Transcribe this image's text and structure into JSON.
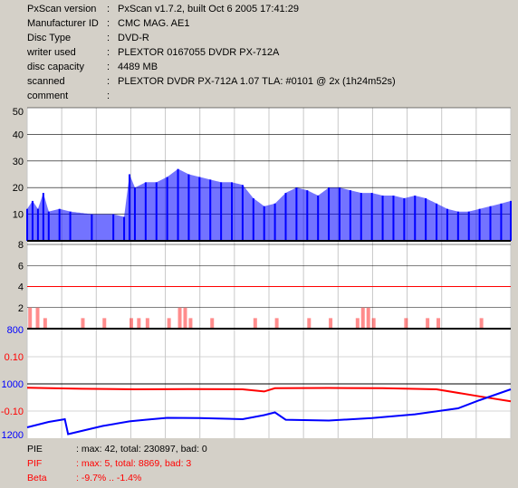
{
  "info": [
    {
      "key": "PxScan version",
      "value": "PxScan v1.7.2, built Oct  6 2005 17:41:29"
    },
    {
      "key": "Manufacturer ID",
      "value": "CMC MAG. AE1"
    },
    {
      "key": "Disc Type",
      "value": "DVD-R"
    },
    {
      "key": "writer used",
      "value": "PLEXTOR 0167055 DVDR PX-712A"
    },
    {
      "key": "disc capacity",
      "value": "4489 MB"
    },
    {
      "key": "scanned",
      "value": "PLEXTOR DVDR PX-712A 1.07 TLA: #0101 @ 2x (1h24m52s)"
    },
    {
      "key": "comment",
      "value": ""
    }
  ],
  "separator": ":",
  "summary": [
    {
      "key": "PIE",
      "value": ": max: 42, total: 230897, bad: 0",
      "color": "#000000"
    },
    {
      "key": "PIF",
      "value": ": max: 5, total: 8869, bad: 3",
      "color": "#ff0000"
    },
    {
      "key": "Beta",
      "value": ": -9.7% .. -1.4%",
      "color": "#ff0000"
    }
  ],
  "colors": {
    "background": "#d4d0c8",
    "plot_bg": "#ffffff",
    "pie": "#0000ff",
    "pif": "#ff0000",
    "beta": "#ff0000",
    "jitter": "#0000ff",
    "grid": "#c8c8c8",
    "baseline": "#000000"
  },
  "chart_data": [
    {
      "type": "area",
      "name": "PIE",
      "ylim": [
        0,
        50
      ],
      "yticks": [
        {
          "v": 10,
          "label": "10"
        },
        {
          "v": 20,
          "label": "20"
        },
        {
          "v": 30,
          "label": "30"
        },
        {
          "v": 40,
          "label": "40"
        },
        {
          "v": 50,
          "label": "50"
        }
      ],
      "xrange_mb": [
        0,
        4489
      ],
      "grid": true,
      "points": [
        [
          0,
          12
        ],
        [
          50,
          15
        ],
        [
          100,
          12
        ],
        [
          150,
          18
        ],
        [
          200,
          11
        ],
        [
          300,
          12
        ],
        [
          400,
          11
        ],
        [
          600,
          10
        ],
        [
          800,
          10
        ],
        [
          900,
          9
        ],
        [
          950,
          25
        ],
        [
          1000,
          20
        ],
        [
          1100,
          22
        ],
        [
          1200,
          22
        ],
        [
          1300,
          24
        ],
        [
          1400,
          27
        ],
        [
          1500,
          25
        ],
        [
          1600,
          24
        ],
        [
          1700,
          23
        ],
        [
          1800,
          22
        ],
        [
          1900,
          22
        ],
        [
          2000,
          21
        ],
        [
          2100,
          16
        ],
        [
          2200,
          13
        ],
        [
          2300,
          14
        ],
        [
          2400,
          18
        ],
        [
          2500,
          20
        ],
        [
          2600,
          19
        ],
        [
          2700,
          17
        ],
        [
          2800,
          20
        ],
        [
          2900,
          20
        ],
        [
          3000,
          19
        ],
        [
          3100,
          18
        ],
        [
          3200,
          18
        ],
        [
          3300,
          17
        ],
        [
          3400,
          17
        ],
        [
          3500,
          16
        ],
        [
          3600,
          17
        ],
        [
          3700,
          16
        ],
        [
          3800,
          14
        ],
        [
          3900,
          12
        ],
        [
          4000,
          11
        ],
        [
          4100,
          11
        ],
        [
          4200,
          12
        ],
        [
          4300,
          13
        ],
        [
          4400,
          14
        ],
        [
          4489,
          15
        ]
      ]
    },
    {
      "type": "bar",
      "name": "PIF",
      "ylim": [
        0,
        8
      ],
      "yticks": [
        {
          "v": 2,
          "label": "2"
        },
        {
          "v": 4,
          "label": "4"
        },
        {
          "v": 6,
          "label": "6"
        },
        {
          "v": 8,
          "label": "8"
        }
      ],
      "threshold": 4,
      "points": [
        [
          10,
          2
        ],
        [
          80,
          2
        ],
        [
          150,
          1
        ],
        [
          500,
          1
        ],
        [
          700,
          1
        ],
        [
          950,
          1
        ],
        [
          1020,
          1
        ],
        [
          1100,
          1
        ],
        [
          1300,
          1
        ],
        [
          1400,
          2
        ],
        [
          1450,
          2
        ],
        [
          1500,
          1
        ],
        [
          1700,
          1
        ],
        [
          2100,
          1
        ],
        [
          2300,
          1
        ],
        [
          2600,
          1
        ],
        [
          2800,
          1
        ],
        [
          3050,
          1
        ],
        [
          3100,
          2
        ],
        [
          3150,
          2
        ],
        [
          3200,
          1
        ],
        [
          3500,
          1
        ],
        [
          3700,
          1
        ],
        [
          3800,
          1
        ],
        [
          4200,
          1
        ]
      ]
    },
    {
      "type": "line",
      "name": "Beta / Jitter",
      "yticks": [
        {
          "label": "800",
          "color": "#0000ff"
        },
        {
          "label": "0.10",
          "color": "#ff0000"
        },
        {
          "label": "1000",
          "color": "#0000ff"
        },
        {
          "label": "-0.10",
          "color": "#ff0000"
        },
        {
          "label": "1200",
          "color": "#0000ff"
        }
      ],
      "beta_points": [
        [
          0,
          -0.014
        ],
        [
          500,
          -0.018
        ],
        [
          1000,
          -0.02
        ],
        [
          1500,
          -0.019
        ],
        [
          2000,
          -0.02
        ],
        [
          2200,
          -0.028
        ],
        [
          2300,
          -0.016
        ],
        [
          2800,
          -0.015
        ],
        [
          3300,
          -0.016
        ],
        [
          3800,
          -0.02
        ],
        [
          4200,
          -0.046
        ],
        [
          4489,
          -0.064
        ]
      ],
      "jitter_points": [
        [
          0,
          1160
        ],
        [
          200,
          1140
        ],
        [
          350,
          1130
        ],
        [
          380,
          1185
        ],
        [
          700,
          1155
        ],
        [
          950,
          1138
        ],
        [
          1100,
          1132
        ],
        [
          1300,
          1125
        ],
        [
          1600,
          1126
        ],
        [
          2000,
          1130
        ],
        [
          2200,
          1115
        ],
        [
          2300,
          1105
        ],
        [
          2400,
          1132
        ],
        [
          2800,
          1135
        ],
        [
          3200,
          1126
        ],
        [
          3600,
          1112
        ],
        [
          4000,
          1090
        ],
        [
          4200,
          1060
        ],
        [
          4489,
          1020
        ]
      ]
    }
  ]
}
